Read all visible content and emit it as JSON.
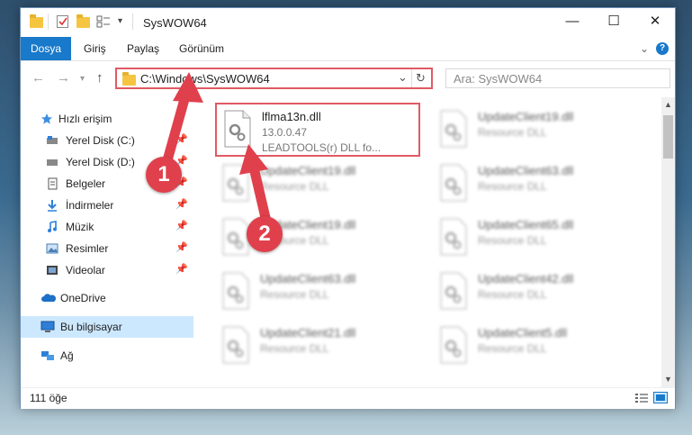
{
  "window": {
    "title": "SysWOW64",
    "controls": {
      "minimize": "—",
      "maximize": "☐",
      "close": "✕"
    }
  },
  "ribbon": {
    "tabs": [
      {
        "label": "Dosya"
      },
      {
        "label": "Giriş"
      },
      {
        "label": "Paylaş"
      },
      {
        "label": "Görünüm"
      }
    ],
    "expand_glyph": "⌄",
    "help_glyph": "?"
  },
  "addressbar": {
    "path": "C:\\Windows\\SysWOW64",
    "dropdown_glyph": "⌄",
    "refresh_glyph": "↻"
  },
  "search": {
    "placeholder": "Ara: SysWOW64"
  },
  "sidebar": {
    "items": [
      {
        "label": "Hızlı erişim",
        "icon": "star-icon"
      },
      {
        "label": "Yerel Disk (C:)",
        "icon": "drive-icon"
      },
      {
        "label": "Yerel Disk (D:)",
        "icon": "drive-icon"
      },
      {
        "label": "Belgeler",
        "icon": "document-icon"
      },
      {
        "label": "İndirmeler",
        "icon": "download-icon"
      },
      {
        "label": "Müzik",
        "icon": "music-icon"
      },
      {
        "label": "Resimler",
        "icon": "pictures-icon"
      },
      {
        "label": "Videolar",
        "icon": "video-icon"
      },
      {
        "label": "OneDrive",
        "icon": "cloud-icon"
      },
      {
        "label": "Bu bilgisayar",
        "icon": "computer-icon"
      },
      {
        "label": "Ağ",
        "icon": "network-icon"
      }
    ]
  },
  "files": [
    {
      "name": "lflma13n.dll",
      "sub1": "13.0.0.47",
      "sub2": "LEADTOOLS(r) DLL fo..."
    },
    {
      "name": "UpdateClient19.dll",
      "sub1": "Resource DLL"
    },
    {
      "name": "UpdateClient19.dll",
      "sub1": "Resource DLL"
    },
    {
      "name": "UpdateClient63.dll",
      "sub1": "Resource DLL"
    },
    {
      "name": "UpdateClient19.dll",
      "sub1": "Resource DLL"
    },
    {
      "name": "UpdateClient65.dll",
      "sub1": "Resource DLL"
    },
    {
      "name": "UpdateClient63.dll",
      "sub1": "Resource DLL"
    },
    {
      "name": "UpdateClient42.dll",
      "sub1": "Resource DLL"
    },
    {
      "name": "UpdateClient21.dll",
      "sub1": "Resource DLL"
    },
    {
      "name": "UpdateClient5.dll",
      "sub1": "Resource DLL"
    }
  ],
  "status": {
    "count": "111 öğe"
  },
  "annotations": {
    "step1": "1",
    "step2": "2",
    "color": "#e0404c"
  }
}
